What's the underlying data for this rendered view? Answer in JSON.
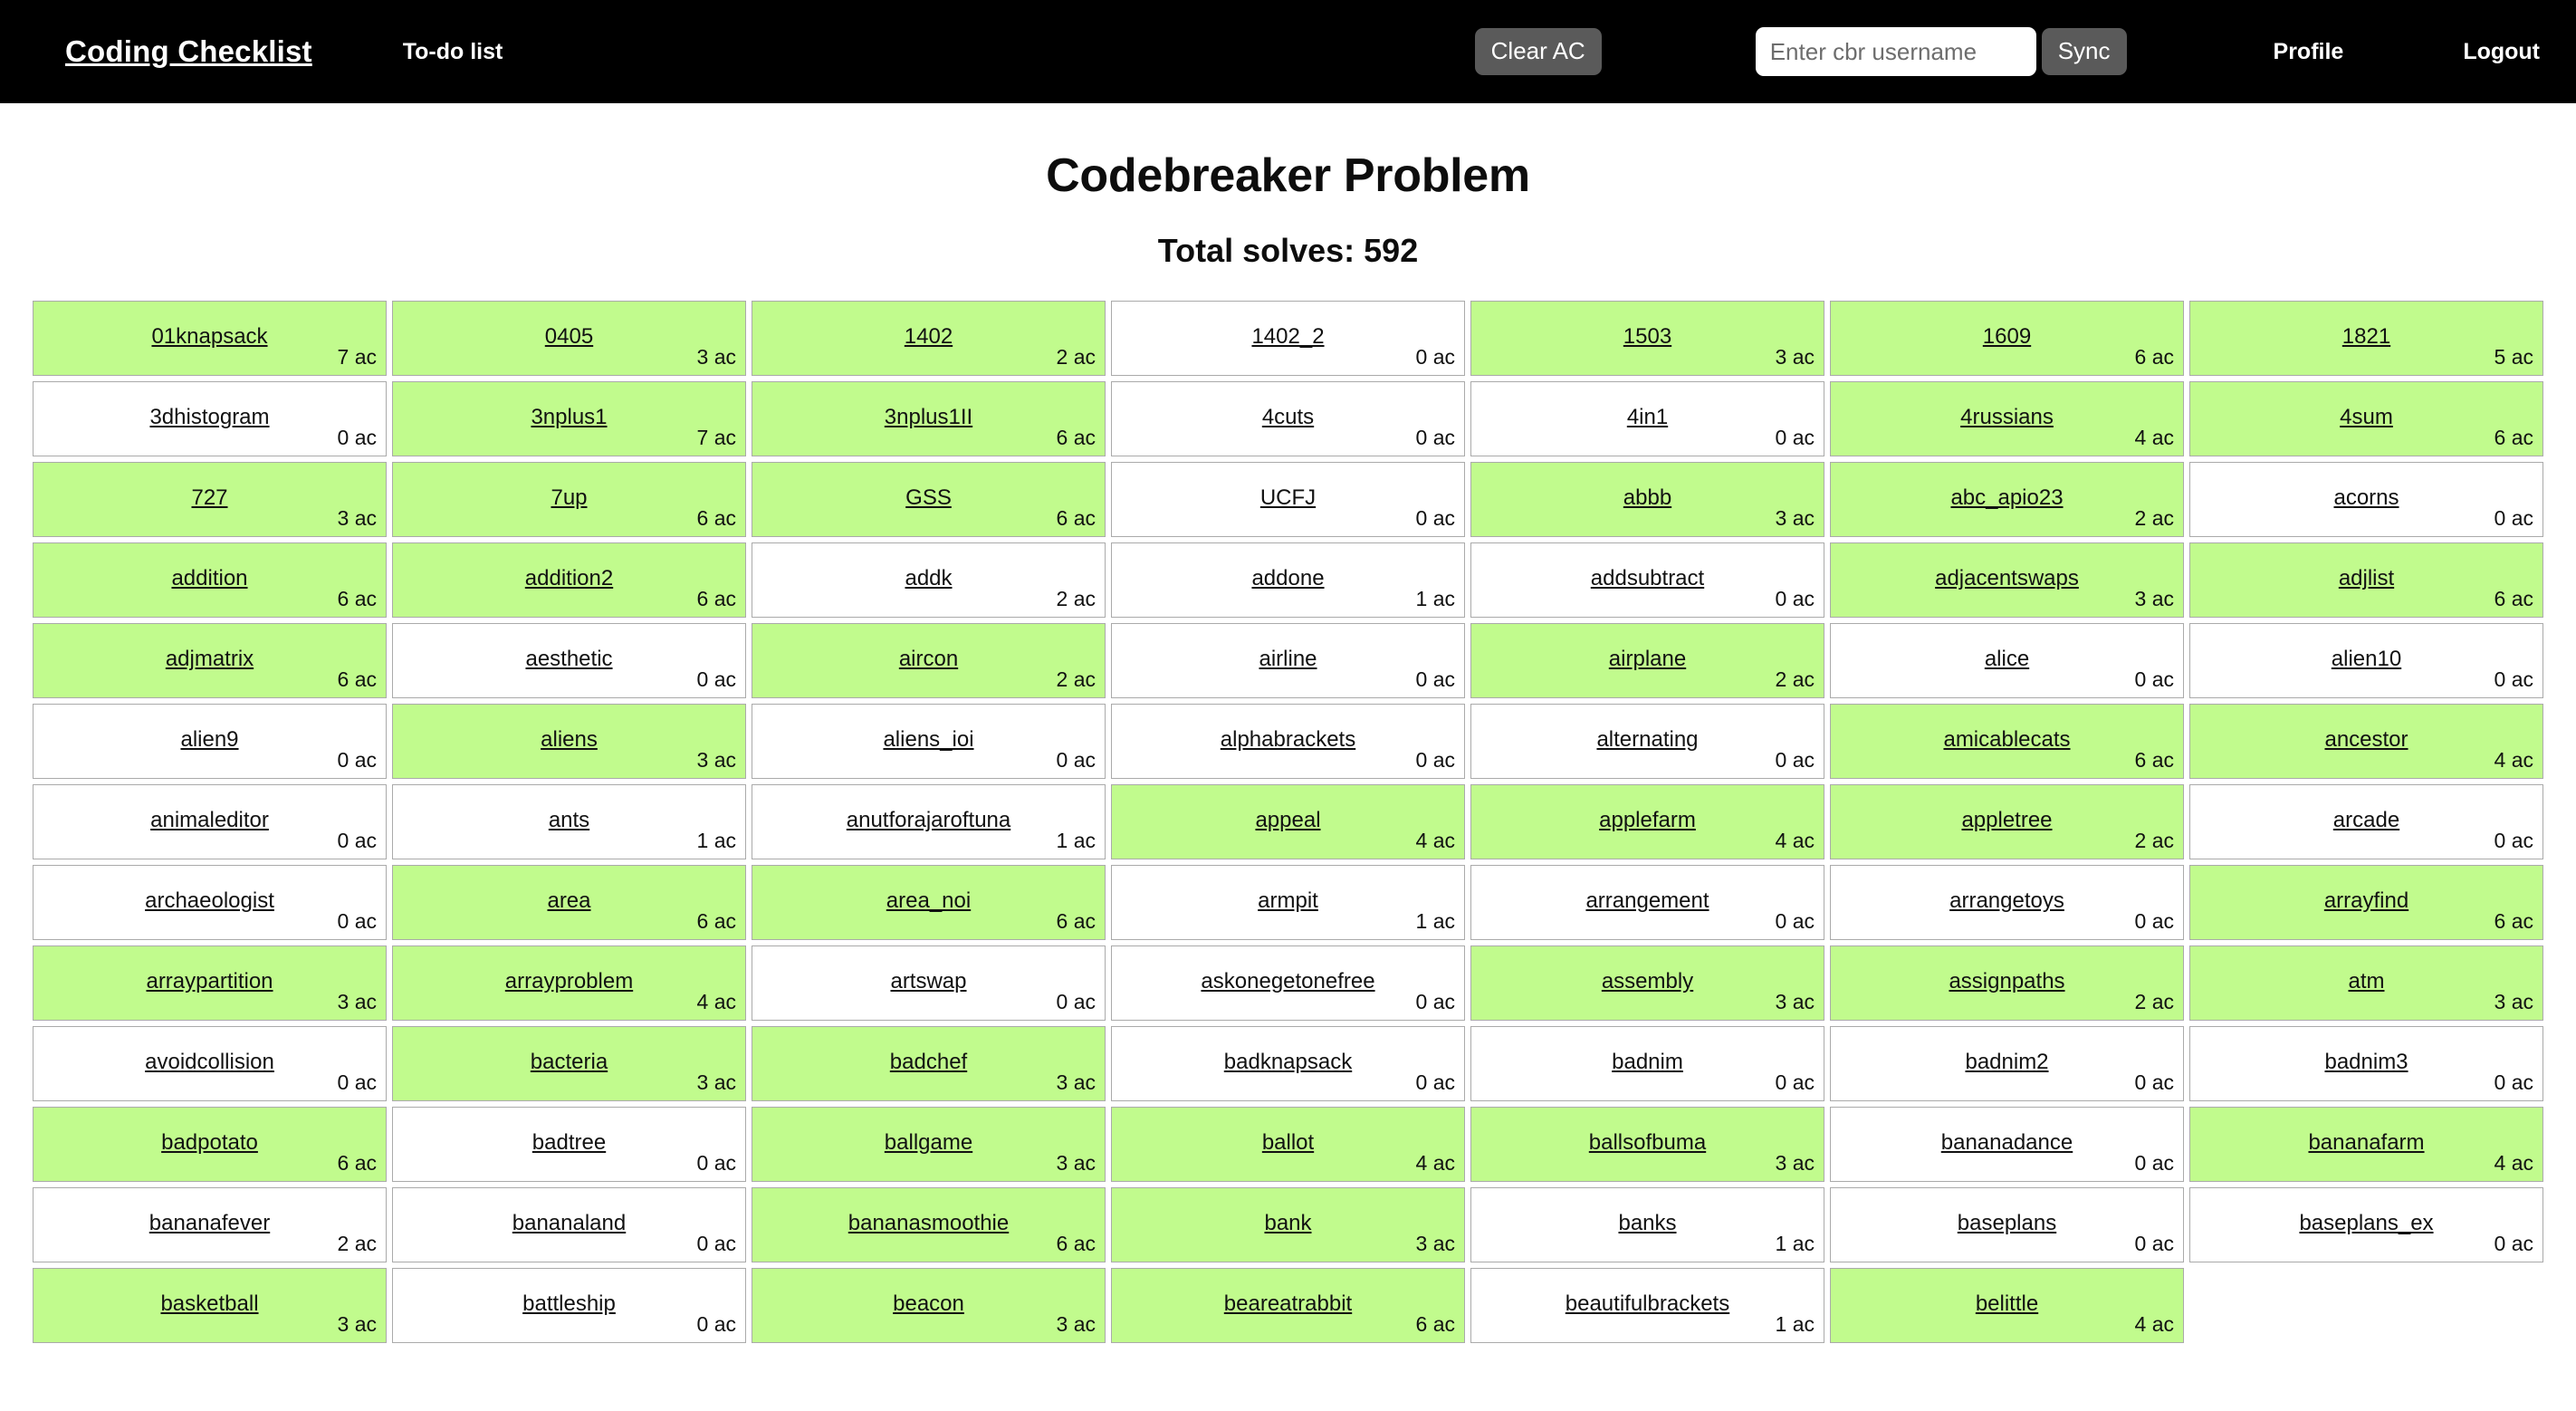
{
  "navbar": {
    "brand": "Coding Checklist",
    "todo_link": "To-do list",
    "clear_ac_label": "Clear AC",
    "username_placeholder": "Enter cbr username",
    "username_value": "",
    "sync_label": "Sync",
    "profile_label": "Profile",
    "logout_label": "Logout",
    "background_color": "#000000",
    "button_color": "#5a5a5a"
  },
  "page": {
    "title": "Codebreaker Problem",
    "total_solves_label": "Total solves: 592",
    "total_solves": 592
  },
  "grid": {
    "columns": 7,
    "solved_color": "#c1fb8d",
    "unsolved_color": "#ffffff",
    "border_color": "#aaaaaa",
    "ac_suffix": "ac",
    "cells": [
      {
        "name": "01knapsack",
        "ac": "7 ac",
        "solved": true
      },
      {
        "name": "0405",
        "ac": "3 ac",
        "solved": true
      },
      {
        "name": "1402",
        "ac": "2 ac",
        "solved": true
      },
      {
        "name": "1402_2",
        "ac": "0 ac",
        "solved": false
      },
      {
        "name": "1503",
        "ac": "3 ac",
        "solved": true
      },
      {
        "name": "1609",
        "ac": "6 ac",
        "solved": true
      },
      {
        "name": "1821",
        "ac": "5 ac",
        "solved": true
      },
      {
        "name": "3dhistogram",
        "ac": "0 ac",
        "solved": false
      },
      {
        "name": "3nplus1",
        "ac": "7 ac",
        "solved": true
      },
      {
        "name": "3nplus1II",
        "ac": "6 ac",
        "solved": true
      },
      {
        "name": "4cuts",
        "ac": "0 ac",
        "solved": false
      },
      {
        "name": "4in1",
        "ac": "0 ac",
        "solved": false
      },
      {
        "name": "4russians",
        "ac": "4 ac",
        "solved": true
      },
      {
        "name": "4sum",
        "ac": "6 ac",
        "solved": true
      },
      {
        "name": "727",
        "ac": "3 ac",
        "solved": true
      },
      {
        "name": "7up",
        "ac": "6 ac",
        "solved": true
      },
      {
        "name": "GSS",
        "ac": "6 ac",
        "solved": true
      },
      {
        "name": "UCFJ",
        "ac": "0 ac",
        "solved": false
      },
      {
        "name": "abbb",
        "ac": "3 ac",
        "solved": true
      },
      {
        "name": "abc_apio23",
        "ac": "2 ac",
        "solved": true
      },
      {
        "name": "acorns",
        "ac": "0 ac",
        "solved": false
      },
      {
        "name": "addition",
        "ac": "6 ac",
        "solved": true
      },
      {
        "name": "addition2",
        "ac": "6 ac",
        "solved": true
      },
      {
        "name": "addk",
        "ac": "2 ac",
        "solved": false
      },
      {
        "name": "addone",
        "ac": "1 ac",
        "solved": false
      },
      {
        "name": "addsubtract",
        "ac": "0 ac",
        "solved": false
      },
      {
        "name": "adjacentswaps",
        "ac": "3 ac",
        "solved": true
      },
      {
        "name": "adjlist",
        "ac": "6 ac",
        "solved": true
      },
      {
        "name": "adjmatrix",
        "ac": "6 ac",
        "solved": true
      },
      {
        "name": "aesthetic",
        "ac": "0 ac",
        "solved": false
      },
      {
        "name": "aircon",
        "ac": "2 ac",
        "solved": true
      },
      {
        "name": "airline",
        "ac": "0 ac",
        "solved": false
      },
      {
        "name": "airplane",
        "ac": "2 ac",
        "solved": true
      },
      {
        "name": "alice",
        "ac": "0 ac",
        "solved": false
      },
      {
        "name": "alien10",
        "ac": "0 ac",
        "solved": false
      },
      {
        "name": "alien9",
        "ac": "0 ac",
        "solved": false
      },
      {
        "name": "aliens",
        "ac": "3 ac",
        "solved": true
      },
      {
        "name": "aliens_ioi",
        "ac": "0 ac",
        "solved": false
      },
      {
        "name": "alphabrackets",
        "ac": "0 ac",
        "solved": false
      },
      {
        "name": "alternating",
        "ac": "0 ac",
        "solved": false
      },
      {
        "name": "amicablecats",
        "ac": "6 ac",
        "solved": true
      },
      {
        "name": "ancestor",
        "ac": "4 ac",
        "solved": true
      },
      {
        "name": "animaleditor",
        "ac": "0 ac",
        "solved": false
      },
      {
        "name": "ants",
        "ac": "1 ac",
        "solved": false
      },
      {
        "name": "anutforajaroftuna",
        "ac": "1 ac",
        "solved": false
      },
      {
        "name": "appeal",
        "ac": "4 ac",
        "solved": true
      },
      {
        "name": "applefarm",
        "ac": "4 ac",
        "solved": true
      },
      {
        "name": "appletree",
        "ac": "2 ac",
        "solved": true
      },
      {
        "name": "arcade",
        "ac": "0 ac",
        "solved": false
      },
      {
        "name": "archaeologist",
        "ac": "0 ac",
        "solved": false
      },
      {
        "name": "area",
        "ac": "6 ac",
        "solved": true
      },
      {
        "name": "area_noi",
        "ac": "6 ac",
        "solved": true
      },
      {
        "name": "armpit",
        "ac": "1 ac",
        "solved": false
      },
      {
        "name": "arrangement",
        "ac": "0 ac",
        "solved": false
      },
      {
        "name": "arrangetoys",
        "ac": "0 ac",
        "solved": false
      },
      {
        "name": "arrayfind",
        "ac": "6 ac",
        "solved": true
      },
      {
        "name": "arraypartition",
        "ac": "3 ac",
        "solved": true
      },
      {
        "name": "arrayproblem",
        "ac": "4 ac",
        "solved": true
      },
      {
        "name": "artswap",
        "ac": "0 ac",
        "solved": false
      },
      {
        "name": "askonegetonefree",
        "ac": "0 ac",
        "solved": false
      },
      {
        "name": "assembly",
        "ac": "3 ac",
        "solved": true
      },
      {
        "name": "assignpaths",
        "ac": "2 ac",
        "solved": true
      },
      {
        "name": "atm",
        "ac": "3 ac",
        "solved": true
      },
      {
        "name": "avoidcollision",
        "ac": "0 ac",
        "solved": false
      },
      {
        "name": "bacteria",
        "ac": "3 ac",
        "solved": true
      },
      {
        "name": "badchef",
        "ac": "3 ac",
        "solved": true
      },
      {
        "name": "badknapsack",
        "ac": "0 ac",
        "solved": false
      },
      {
        "name": "badnim",
        "ac": "0 ac",
        "solved": false
      },
      {
        "name": "badnim2",
        "ac": "0 ac",
        "solved": false
      },
      {
        "name": "badnim3",
        "ac": "0 ac",
        "solved": false
      },
      {
        "name": "badpotato",
        "ac": "6 ac",
        "solved": true
      },
      {
        "name": "badtree",
        "ac": "0 ac",
        "solved": false
      },
      {
        "name": "ballgame",
        "ac": "3 ac",
        "solved": true
      },
      {
        "name": "ballot",
        "ac": "4 ac",
        "solved": true
      },
      {
        "name": "ballsofbuma",
        "ac": "3 ac",
        "solved": true
      },
      {
        "name": "bananadance",
        "ac": "0 ac",
        "solved": false
      },
      {
        "name": "bananafarm",
        "ac": "4 ac",
        "solved": true
      },
      {
        "name": "bananafever",
        "ac": "2 ac",
        "solved": false
      },
      {
        "name": "bananaland",
        "ac": "0 ac",
        "solved": false
      },
      {
        "name": "bananasmoothie",
        "ac": "6 ac",
        "solved": true
      },
      {
        "name": "bank",
        "ac": "3 ac",
        "solved": true
      },
      {
        "name": "banks",
        "ac": "1 ac",
        "solved": false
      },
      {
        "name": "baseplans",
        "ac": "0 ac",
        "solved": false
      },
      {
        "name": "baseplans_ex",
        "ac": "0 ac",
        "solved": false
      },
      {
        "name": "basketball",
        "ac": "3 ac",
        "solved": true
      },
      {
        "name": "battleship",
        "ac": "0 ac",
        "solved": false
      },
      {
        "name": "beacon",
        "ac": "3 ac",
        "solved": true
      },
      {
        "name": "beareatrabbit",
        "ac": "6 ac",
        "solved": true
      },
      {
        "name": "beautifulbrackets",
        "ac": "1 ac",
        "solved": false
      },
      {
        "name": "belittle",
        "ac": "4 ac",
        "solved": true
      }
    ]
  }
}
